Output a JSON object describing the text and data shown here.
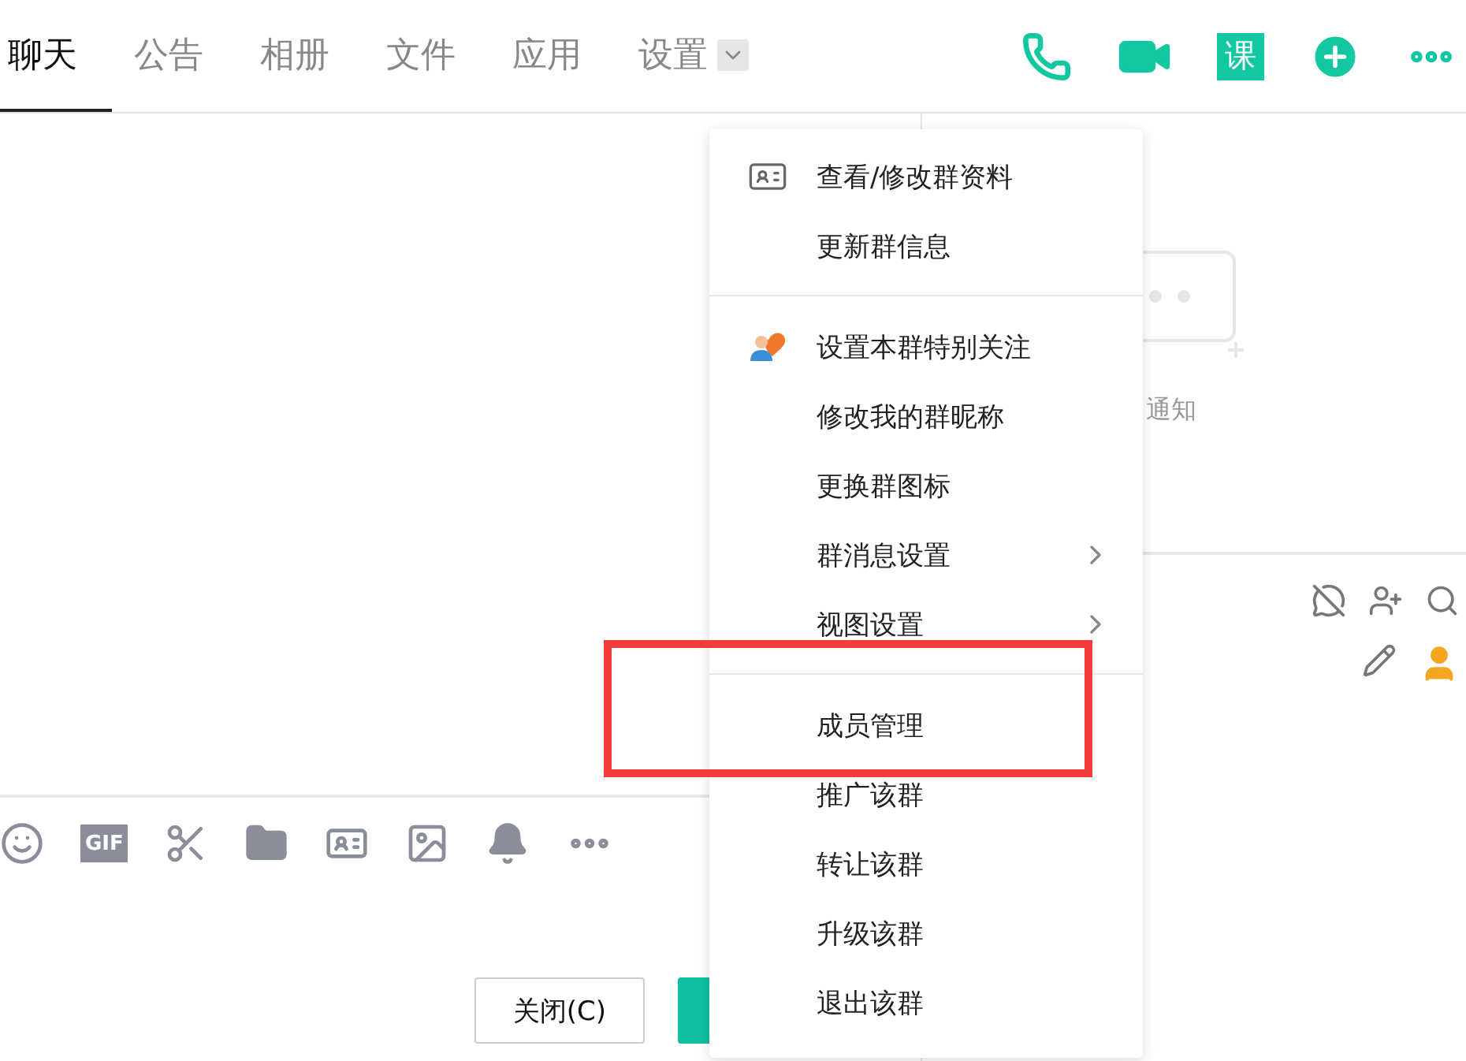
{
  "tabs": [
    {
      "label": "聊天",
      "selected": true,
      "has_dropdown": false
    },
    {
      "label": "公告",
      "selected": false,
      "has_dropdown": false
    },
    {
      "label": "相册",
      "selected": false,
      "has_dropdown": false
    },
    {
      "label": "文件",
      "selected": false,
      "has_dropdown": false
    },
    {
      "label": "应用",
      "selected": false,
      "has_dropdown": false
    },
    {
      "label": "设置",
      "selected": false,
      "has_dropdown": true
    }
  ],
  "course_badge": "课",
  "toolbar": {
    "gif_label": "GIF"
  },
  "buttons": [
    {
      "label": "关闭(C)",
      "kind": "secondary"
    },
    {
      "kind": "primary"
    }
  ],
  "notice_panel": {
    "empty_text": "通知"
  },
  "menu": {
    "sections": [
      [
        {
          "label": "查看/修改群资料",
          "kind": "card",
          "highlighted": false
        },
        {
          "label": "更新群信息",
          "kind": "plain",
          "highlighted": false
        }
      ],
      [
        {
          "label": "设置本群特别关注",
          "kind": "heart",
          "highlighted": false
        },
        {
          "label": "修改我的群昵称",
          "kind": "plain",
          "highlighted": false
        },
        {
          "label": "更换群图标",
          "kind": "plain",
          "highlighted": false
        },
        {
          "label": "群消息设置",
          "kind": "submenu",
          "highlighted": false
        },
        {
          "label": "视图设置",
          "kind": "submenu",
          "highlighted": false
        }
      ],
      [
        {
          "label": "成员管理",
          "kind": "plain",
          "highlighted": true
        },
        {
          "label": "推广该群",
          "kind": "plain",
          "highlighted": false
        },
        {
          "label": "转让该群",
          "kind": "plain",
          "highlighted": false
        },
        {
          "label": "升级该群",
          "kind": "plain",
          "highlighted": false
        },
        {
          "label": "退出该群",
          "kind": "plain",
          "highlighted": false
        }
      ]
    ]
  }
}
